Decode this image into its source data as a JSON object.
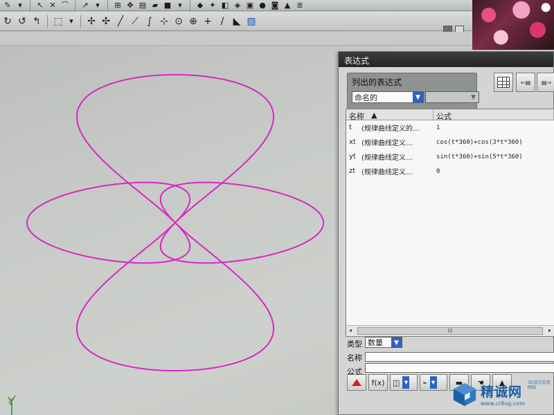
{
  "toolbar_row1": {
    "icons": [
      "drawing-tool-icon",
      "select-arrow-icon",
      "cross-arrow-icon",
      "brush-icon",
      "cursor-icon",
      "grid-icon",
      "move-icon",
      "layer-icon",
      "paint-icon",
      "blocks-icon",
      "diamond-icon",
      "star-icon"
    ]
  },
  "toolbar_row2": {
    "icons": [
      "rotate-icon",
      "pan-icon",
      "snap-icon",
      "rect-select-icon",
      "point-icon",
      "move-icon",
      "line-icon",
      "slash-icon",
      "curve-icon",
      "point-on-icon",
      "circle-center-icon",
      "circle-icon",
      "plus-icon",
      "slash-icon",
      "black-shape-icon",
      "cube-icon"
    ]
  },
  "dialog": {
    "title": "表达式",
    "list_group_label": "列出的表达式",
    "filter_selected": "命名的",
    "filter_secondary": "",
    "table": {
      "columns": [
        "名称",
        "公式"
      ],
      "sort_indicator": "▲",
      "rows": [
        {
          "id": "t",
          "desc": "(规律曲线定义的…",
          "formula": "1"
        },
        {
          "id": "xt",
          "desc": "(规律曲线定义…",
          "formula": "cos(t*360)+cos(3*t*360)"
        },
        {
          "id": "yt",
          "desc": "(规律曲线定义…",
          "formula": "sin(t*360)+sin(5*t*360)"
        },
        {
          "id": "zt",
          "desc": "(规律曲线定义…",
          "formula": "0"
        }
      ],
      "scroll_grip": "III"
    },
    "type_label": "类型",
    "type_value": "数量",
    "name_label": "名称",
    "formula_label": "公式",
    "fx_label": "f(x)"
  },
  "curve": {
    "color": "#d926c8",
    "xt": "cos(t*360)+cos(3*t*360)",
    "yt": "sin(t*360)+sin(5*t*360)"
  },
  "watermark": {
    "main": "精诚网",
    "sub": "www.cr8ug.com",
    "small": "3D设计交流网站"
  }
}
